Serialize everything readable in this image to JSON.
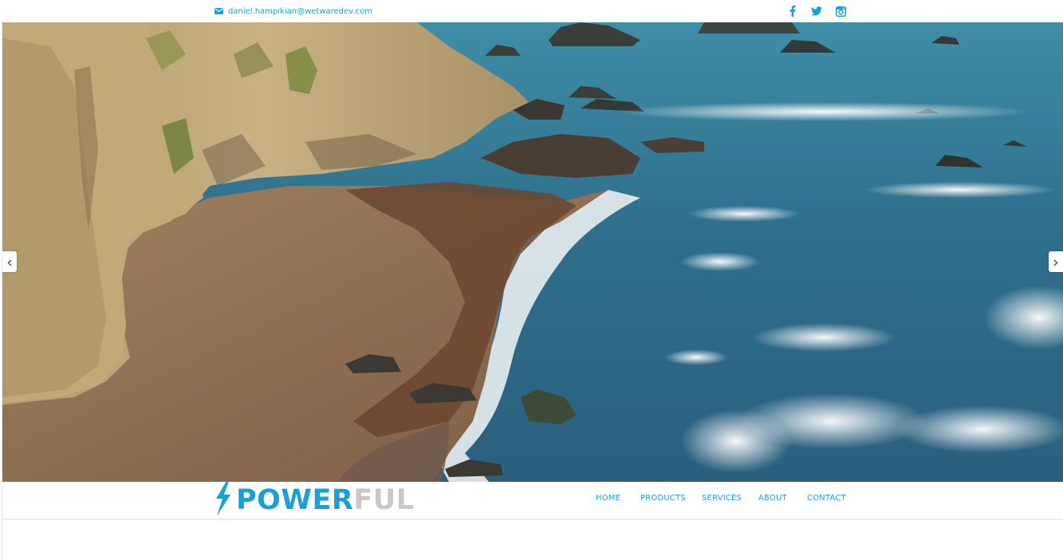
{
  "topbar": {
    "email_icon": "envelope-icon",
    "email": "daniel.hampikian@wetwaredev.com",
    "social": [
      "facebook-icon",
      "twitter-icon",
      "instagram-icon"
    ]
  },
  "hero": {
    "prev_icon": "chevron-left-icon",
    "next_icon": "chevron-right-icon"
  },
  "logo": {
    "icon": "lightning-bolt-icon",
    "text_a": "POWER",
    "text_b": "FUL"
  },
  "nav": {
    "items": [
      "HOME",
      "PRODUCTS",
      "SERVICES",
      "ABOUT",
      "CONTACT"
    ]
  },
  "colors": {
    "accent": "#1a9fd6",
    "logo_gray": "#c9c9c9"
  }
}
